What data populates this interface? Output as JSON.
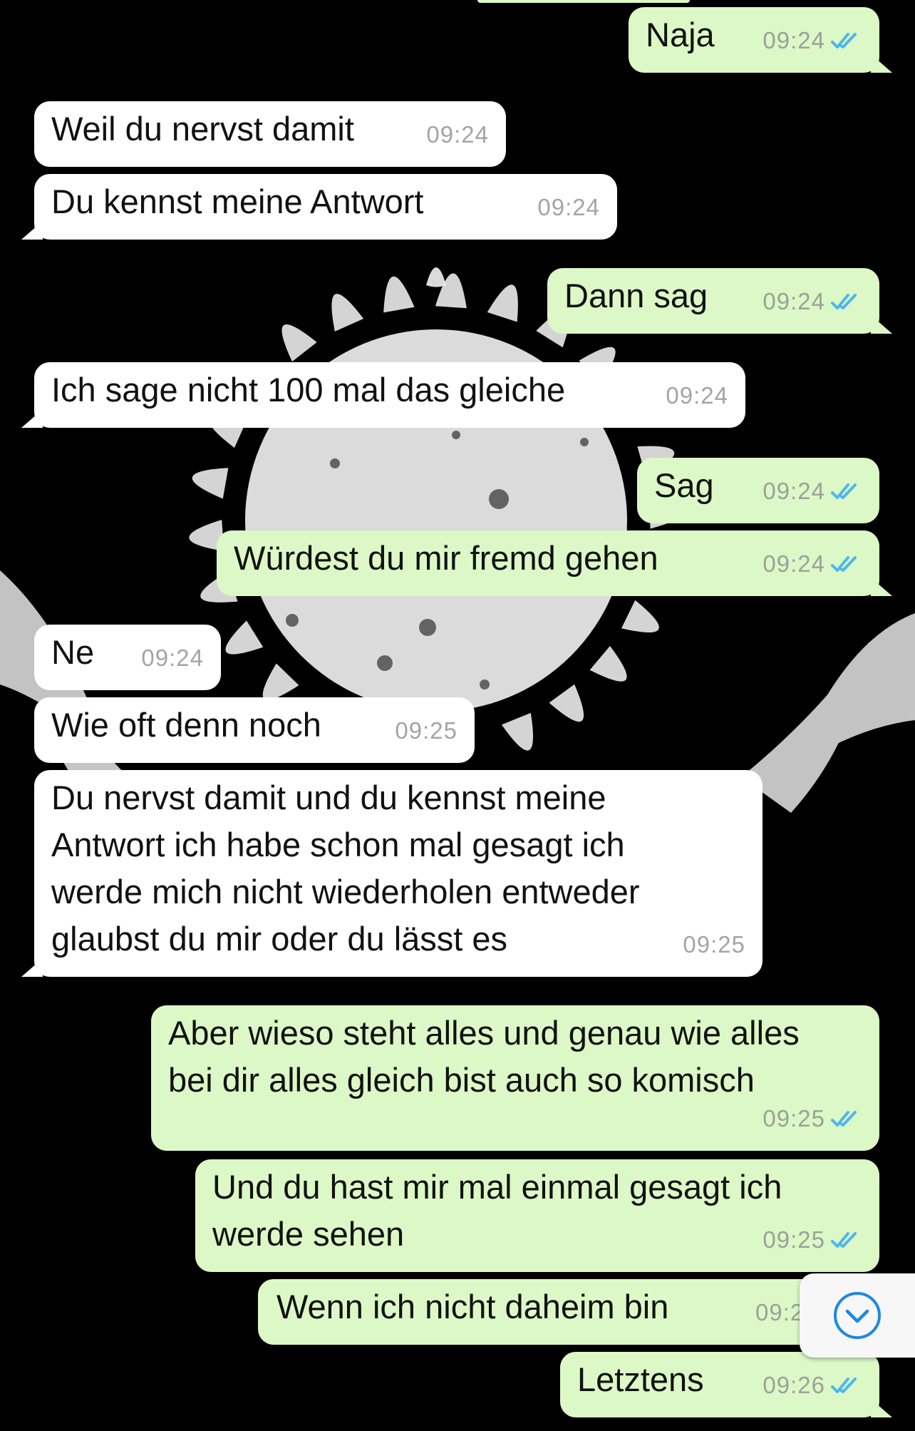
{
  "messages": [
    {
      "dir": "out",
      "text": "Naja",
      "time": "09:24",
      "read": true
    },
    {
      "dir": "in",
      "text": "Weil du nervst damit",
      "time": "09:24"
    },
    {
      "dir": "in",
      "text": "Du kennst meine Antwort",
      "time": "09:24"
    },
    {
      "dir": "out",
      "text": "Dann sag",
      "time": "09:24",
      "read": true
    },
    {
      "dir": "in",
      "text": "Ich sage nicht 100 mal das gleiche",
      "time": "09:24"
    },
    {
      "dir": "out",
      "text": "Sag",
      "time": "09:24",
      "read": true
    },
    {
      "dir": "out",
      "text": "Würdest du mir fremd gehen",
      "time": "09:24",
      "read": true
    },
    {
      "dir": "in",
      "text": "Ne",
      "time": "09:24"
    },
    {
      "dir": "in",
      "text": "Wie oft denn noch",
      "time": "09:25"
    },
    {
      "dir": "in",
      "text": "Du nervst damit und du kennst meine\nAntwort ich habe schon mal gesagt ich\nwerde mich nicht wiederholen entweder\nglaubst du mir oder du lässt es",
      "time": "09:25"
    },
    {
      "dir": "out",
      "text": "Aber wieso steht alles und genau wie alles\nbei dir alles gleich bist auch so komisch",
      "time": "09:25",
      "read": true
    },
    {
      "dir": "out",
      "text": "Und du hast mir mal einmal gesagt ich\nwerde sehen",
      "time": "09:25",
      "read": true
    },
    {
      "dir": "out",
      "text": "Wenn ich nicht daheim bin",
      "time": "09:2",
      "read": false
    },
    {
      "dir": "out",
      "text": "Letztens",
      "time": "09:26",
      "read": true
    }
  ],
  "colors": {
    "incoming_bubble": "#ffffff",
    "outgoing_bubble": "#dcf8c6",
    "read_ticks": "#4fb6ec",
    "wallpaper": "#000000",
    "emblem": "#ececec"
  },
  "icons": {
    "read_receipt": "double-check-icon",
    "scroll_down": "chevron-down-circle-icon",
    "wallpaper": "sun-eagle-emblem"
  }
}
